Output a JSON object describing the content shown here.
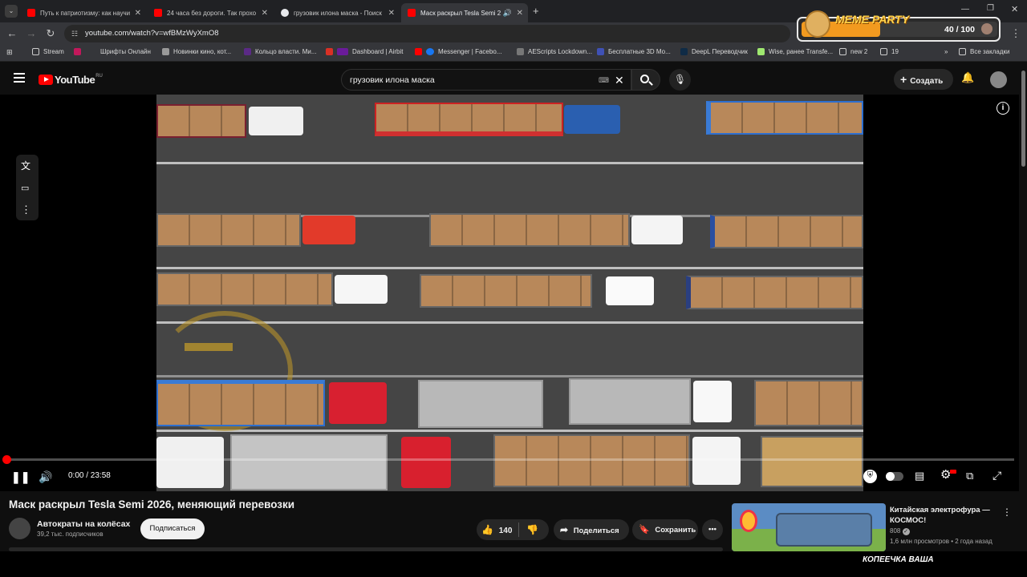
{
  "browser": {
    "tabs": [
      {
        "label": "Путь к патриотизму: как научи",
        "favicon_color": "#ff0000"
      },
      {
        "label": "24 часа без дороги. Так прохо",
        "favicon_color": "#ff0000"
      },
      {
        "label": "грузовик илона маска - Поиск",
        "favicon_color": "#4285f4"
      },
      {
        "label": "Маск раскрыл Tesla Semi 2",
        "favicon_color": "#ff0000"
      }
    ],
    "url": "youtube.com/watch?v=wfBMzWyXmO8",
    "bookmarks": [
      {
        "label": "Stream",
        "icon": "folder-icon"
      },
      {
        "label": "Шрифты Онлайн",
        "icon": "bookmark-icon"
      },
      {
        "label": "Новинки кино, кот...",
        "icon": "bookmark-icon"
      },
      {
        "label": "Кольцо власти. Ми...",
        "icon": "bookmark-icon"
      },
      {
        "label": "Dashboard | Airbit",
        "icon": "bookmark-icon"
      },
      {
        "label": "Messenger | Facebo...",
        "icon": "bookmark-icon"
      },
      {
        "label": "AEScripts Lockdown...",
        "icon": "bookmark-icon"
      },
      {
        "label": "Бесплатные 3D Мо...",
        "icon": "bookmark-icon"
      },
      {
        "label": "DeepL Переводчик",
        "icon": "bookmark-icon"
      },
      {
        "label": "Wise, ранее Transfe...",
        "icon": "bookmark-icon"
      },
      {
        "label": "new 2",
        "icon": "folder-icon"
      },
      {
        "label": "19",
        "icon": "folder-icon"
      }
    ],
    "all_bookmarks": "Все закладки"
  },
  "extension": {
    "title": "MEME PARTY",
    "counter": "40 / 100",
    "progress": 0.4
  },
  "youtube": {
    "logo": "YouTube",
    "region": "RU",
    "search_value": "грузовик илона маска",
    "create_label": "Создать"
  },
  "player": {
    "time": "0:00 / 23:58",
    "progress": 0.0
  },
  "video": {
    "title": "Маск раскрыл Tesla Semi 2026, меняющий перевозки",
    "channel": "Автократы на колёсах",
    "subscribers": "39,2 тыс. подписчиков",
    "subscribe_label": "Подписаться",
    "likes": "140",
    "share_label": "Поделиться",
    "save_label": "Сохранить"
  },
  "recommendation": {
    "title": "Китайская электрофура — КОСМОС!",
    "channel": "808",
    "meta": "1,6 млн просмотров • 2 года назад"
  },
  "overlay_text": "КОПЕЕЧКА ВАША"
}
